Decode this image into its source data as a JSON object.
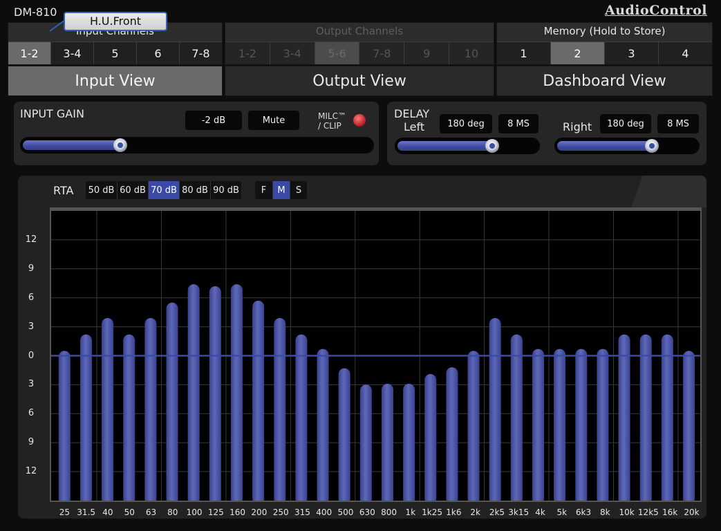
{
  "header": {
    "model": "DM-810",
    "brand": "AudioControl"
  },
  "tooltip": {
    "text": "H.U.Front"
  },
  "input_channels": {
    "title": "Input Channels",
    "items": [
      "1-2",
      "3-4",
      "5",
      "6",
      "7-8"
    ],
    "active": 0
  },
  "output_channels": {
    "title": "Output Channels",
    "items": [
      "1-2",
      "3-4",
      "5-6",
      "7-8",
      "9",
      "10"
    ],
    "active": 2
  },
  "memory": {
    "title": "Memory (Hold to Store)",
    "items": [
      "1",
      "2",
      "3",
      "4"
    ],
    "active": 1
  },
  "views": {
    "tabs": [
      "Input View",
      "Output View",
      "Dashboard View"
    ],
    "active": 0
  },
  "input_gain": {
    "label": "INPUT GAIN",
    "value": "-2 dB",
    "mute_label": "Mute",
    "clip_label_1": "MILC™",
    "clip_label_2": "/ CLIP",
    "slider_level": 0.28
  },
  "delay": {
    "label": "DELAY",
    "left": {
      "label": "Left",
      "phase": "180 deg",
      "time": "8 MS",
      "slider_level": 0.68
    },
    "right": {
      "label": "Right",
      "phase": "180 deg",
      "time": "8 MS",
      "slider_level": 0.68
    }
  },
  "rta": {
    "label": "RTA",
    "ranges": [
      "50 dB",
      "60 dB",
      "70 dB",
      "80 dB",
      "90 dB"
    ],
    "range_active": 2,
    "speeds": [
      "F",
      "M",
      "S"
    ],
    "speed_active": 1
  },
  "colors": {
    "accent": "#3a4aa6",
    "bar": "#5f68b8",
    "led": "#c2262c",
    "tooltip_border": "#2f62b0"
  },
  "chart_data": {
    "type": "bar",
    "xlabel": "",
    "ylabel": "",
    "y_tick_labels": [
      "12",
      "9",
      "6",
      "3",
      "0",
      "3",
      "6",
      "9",
      "12"
    ],
    "ylim": [
      -15,
      15
    ],
    "baseline": 0,
    "categories": [
      "25",
      "31.5",
      "40",
      "50",
      "63",
      "80",
      "100",
      "125",
      "160",
      "200",
      "250",
      "315",
      "400",
      "500",
      "630",
      "800",
      "1k",
      "1k25",
      "1k6",
      "2k",
      "2k5",
      "3k15",
      "4k",
      "5k",
      "6k3",
      "8k",
      "10k",
      "12k5",
      "16k",
      "20k"
    ],
    "values": [
      0.5,
      2.2,
      3.9,
      2.2,
      3.9,
      5.5,
      7.4,
      7.2,
      7.4,
      5.7,
      3.9,
      2.2,
      0.7,
      -1.3,
      -3.0,
      -2.9,
      -2.9,
      -1.9,
      -1.2,
      0.5,
      3.9,
      2.2,
      0.7,
      0.7,
      0.7,
      0.7,
      2.2,
      2.2,
      2.2,
      0.5
    ],
    "grid": true
  }
}
